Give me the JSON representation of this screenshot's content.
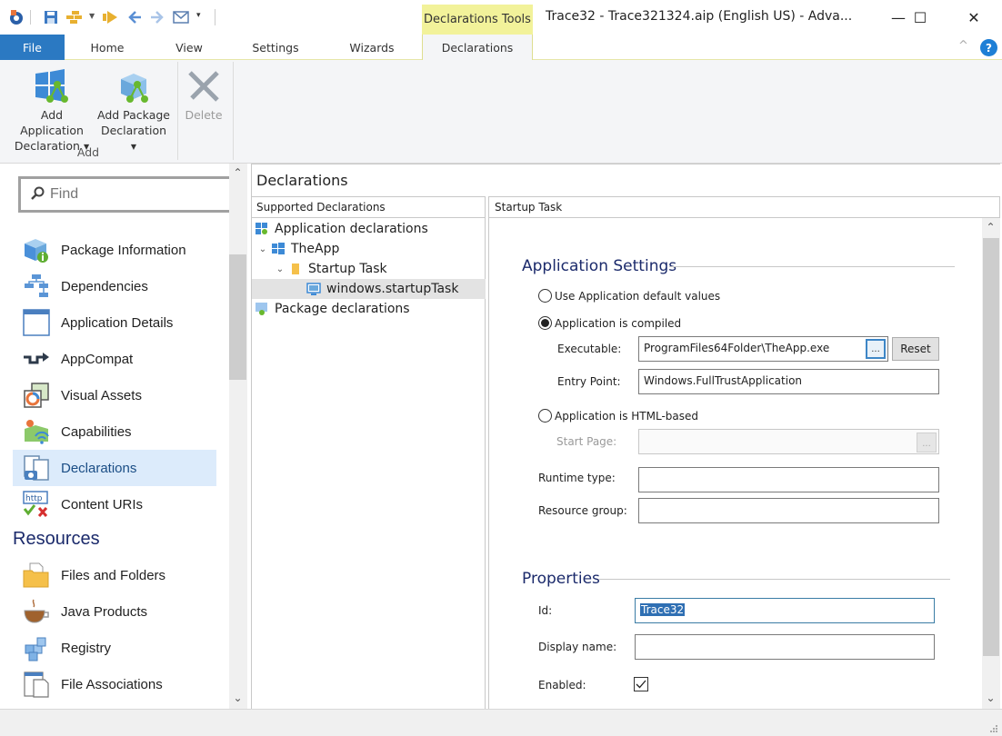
{
  "titlebar": {
    "window_title": "Trace32 - Trace321324.aip (English US) - Adva...",
    "context_tab_group": "Declarations Tools",
    "quick_access": [
      "app-logo",
      "save",
      "build",
      "run",
      "back",
      "forward",
      "email",
      "customize"
    ],
    "controls": {
      "minimize": "—",
      "maximize": "☐",
      "close": "✕"
    }
  },
  "ribbon": {
    "tabs": [
      {
        "label": "File"
      },
      {
        "label": "Home"
      },
      {
        "label": "View"
      },
      {
        "label": "Settings"
      },
      {
        "label": "Wizards"
      },
      {
        "label": "Declarations"
      }
    ],
    "active_tab": "Declarations",
    "buttons": {
      "add_app_decl": {
        "line1": "Add Application",
        "line2": "Declaration"
      },
      "add_pkg_decl": {
        "line1": "Add Package",
        "line2": "Declaration"
      },
      "delete": {
        "label": "Delete"
      }
    },
    "group_label": "Add",
    "collapse_glyph": "^",
    "help_glyph": "?"
  },
  "sidebar": {
    "search_placeholder": "Find",
    "items": [
      {
        "label": "Package Information"
      },
      {
        "label": "Dependencies"
      },
      {
        "label": "Application Details"
      },
      {
        "label": "AppCompat"
      },
      {
        "label": "Visual Assets"
      },
      {
        "label": "Capabilities"
      },
      {
        "label": "Declarations",
        "selected": true
      },
      {
        "label": "Content URIs"
      }
    ],
    "resources_header": "Resources",
    "resources": [
      {
        "label": "Files and Folders"
      },
      {
        "label": "Java Products"
      },
      {
        "label": "Registry"
      },
      {
        "label": "File Associations"
      }
    ]
  },
  "main": {
    "title": "Declarations",
    "tree_header": "Supported Declarations",
    "tree": [
      {
        "label": "Application declarations"
      },
      {
        "label": "TheApp"
      },
      {
        "label": "Startup Task"
      },
      {
        "label": "windows.startupTask",
        "selected": true
      },
      {
        "label": "Package declarations"
      }
    ],
    "detail_header": "Startup Task",
    "app_settings": {
      "title": "Application Settings",
      "radio_default": "Use Application default values",
      "radio_compiled": "Application is compiled",
      "selected_radio": "compiled",
      "executable_label": "Executable:",
      "executable_value": "ProgramFiles64Folder\\TheApp.exe",
      "browse_label": "...",
      "reset_label": "Reset",
      "entry_point_label": "Entry Point:",
      "entry_point_value": "Windows.FullTrustApplication",
      "radio_html": "Application is HTML-based",
      "start_page_label": "Start Page:",
      "start_page_value": "",
      "runtime_type_label": "Runtime type:",
      "runtime_type_value": "",
      "resource_group_label": "Resource group:",
      "resource_group_value": ""
    },
    "properties": {
      "title": "Properties",
      "id_label": "Id:",
      "id_value": "Trace32",
      "display_name_label": "Display name:",
      "display_name_value": "",
      "enabled_label": "Enabled:",
      "enabled": true
    }
  },
  "colors": {
    "accent": "#2b79c2",
    "context_tab": "#f2f29a",
    "section_title": "#1b2a6b",
    "selection": "#dcebfb"
  }
}
